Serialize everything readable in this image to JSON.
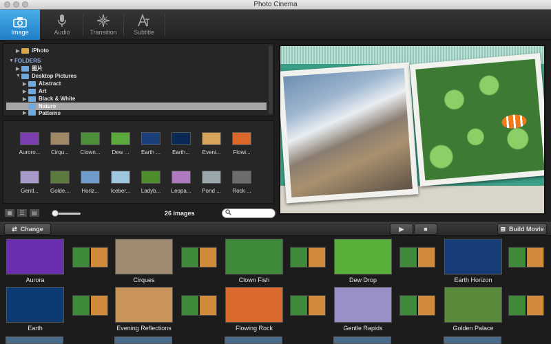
{
  "window": {
    "title": "Photo Cinema"
  },
  "toolbar": {
    "tools": [
      {
        "label": "Image",
        "icon": "camera-icon",
        "active": true
      },
      {
        "label": "Audio",
        "icon": "microphone-icon",
        "active": false
      },
      {
        "label": "Transition",
        "icon": "sparkle-icon",
        "active": false
      },
      {
        "label": "Subtitle",
        "icon": "text-a-icon",
        "active": false
      }
    ]
  },
  "browser": {
    "tree": [
      {
        "label": "iPhoto"
      },
      {
        "label": "FOLDERS"
      },
      {
        "label": "图片"
      },
      {
        "label": "Desktop Pictures"
      },
      {
        "label": "Abstract"
      },
      {
        "label": "Art"
      },
      {
        "label": "Black & White"
      },
      {
        "label": "Nature",
        "selected": true
      },
      {
        "label": "Patterns"
      }
    ],
    "grid": [
      {
        "label": "Auroro...",
        "color": "#7d3fb0"
      },
      {
        "label": "Cirqu...",
        "color": "#a08766"
      },
      {
        "label": "Clown...",
        "color": "#4d8f3a"
      },
      {
        "label": "Dew ...",
        "color": "#5ba83c"
      },
      {
        "label": "Earth ...",
        "color": "#1a3f7a"
      },
      {
        "label": "Earth...",
        "color": "#0a2a55"
      },
      {
        "label": "Eveni...",
        "color": "#d7a45c"
      },
      {
        "label": "Flowi...",
        "color": "#d9682a"
      },
      {
        "label": "Gentl...",
        "color": "#a799c9"
      },
      {
        "label": "Golde...",
        "color": "#5c7a3d"
      },
      {
        "label": "Horiz...",
        "color": "#6f9ccc"
      },
      {
        "label": "Iceber...",
        "color": "#9cc7de"
      },
      {
        "label": "Ladyb...",
        "color": "#4e8d2c"
      },
      {
        "label": "Leopa...",
        "color": "#b07ac0"
      },
      {
        "label": "Pond ...",
        "color": "#9aa8ad"
      },
      {
        "label": "Rock ...",
        "color": "#6c6c6c"
      }
    ],
    "count_label": "26 images",
    "search_placeholder": ""
  },
  "actions": {
    "change_label": "Change",
    "build_label": "Build Movie"
  },
  "timeline": {
    "row1": [
      {
        "label": "Aurora",
        "color": "#6a2fb0"
      },
      {
        "label": "Cirques",
        "color": "#9d8a70"
      },
      {
        "label": "Clown Fish",
        "color": "#3f8a3a"
      },
      {
        "label": "Dew Drop",
        "color": "#5aae3a"
      },
      {
        "label": "Earth Horizon",
        "color": "#173d78"
      }
    ],
    "row2": [
      {
        "label": "Earth",
        "color": "#0e3a73"
      },
      {
        "label": "Evening Reflections",
        "color": "#c9955a"
      },
      {
        "label": "Flowing Rock",
        "color": "#d9692c"
      },
      {
        "label": "Gentle Rapids",
        "color": "#9b8fc8"
      },
      {
        "label": "Golden Palace",
        "color": "#5a8a3c"
      }
    ]
  }
}
